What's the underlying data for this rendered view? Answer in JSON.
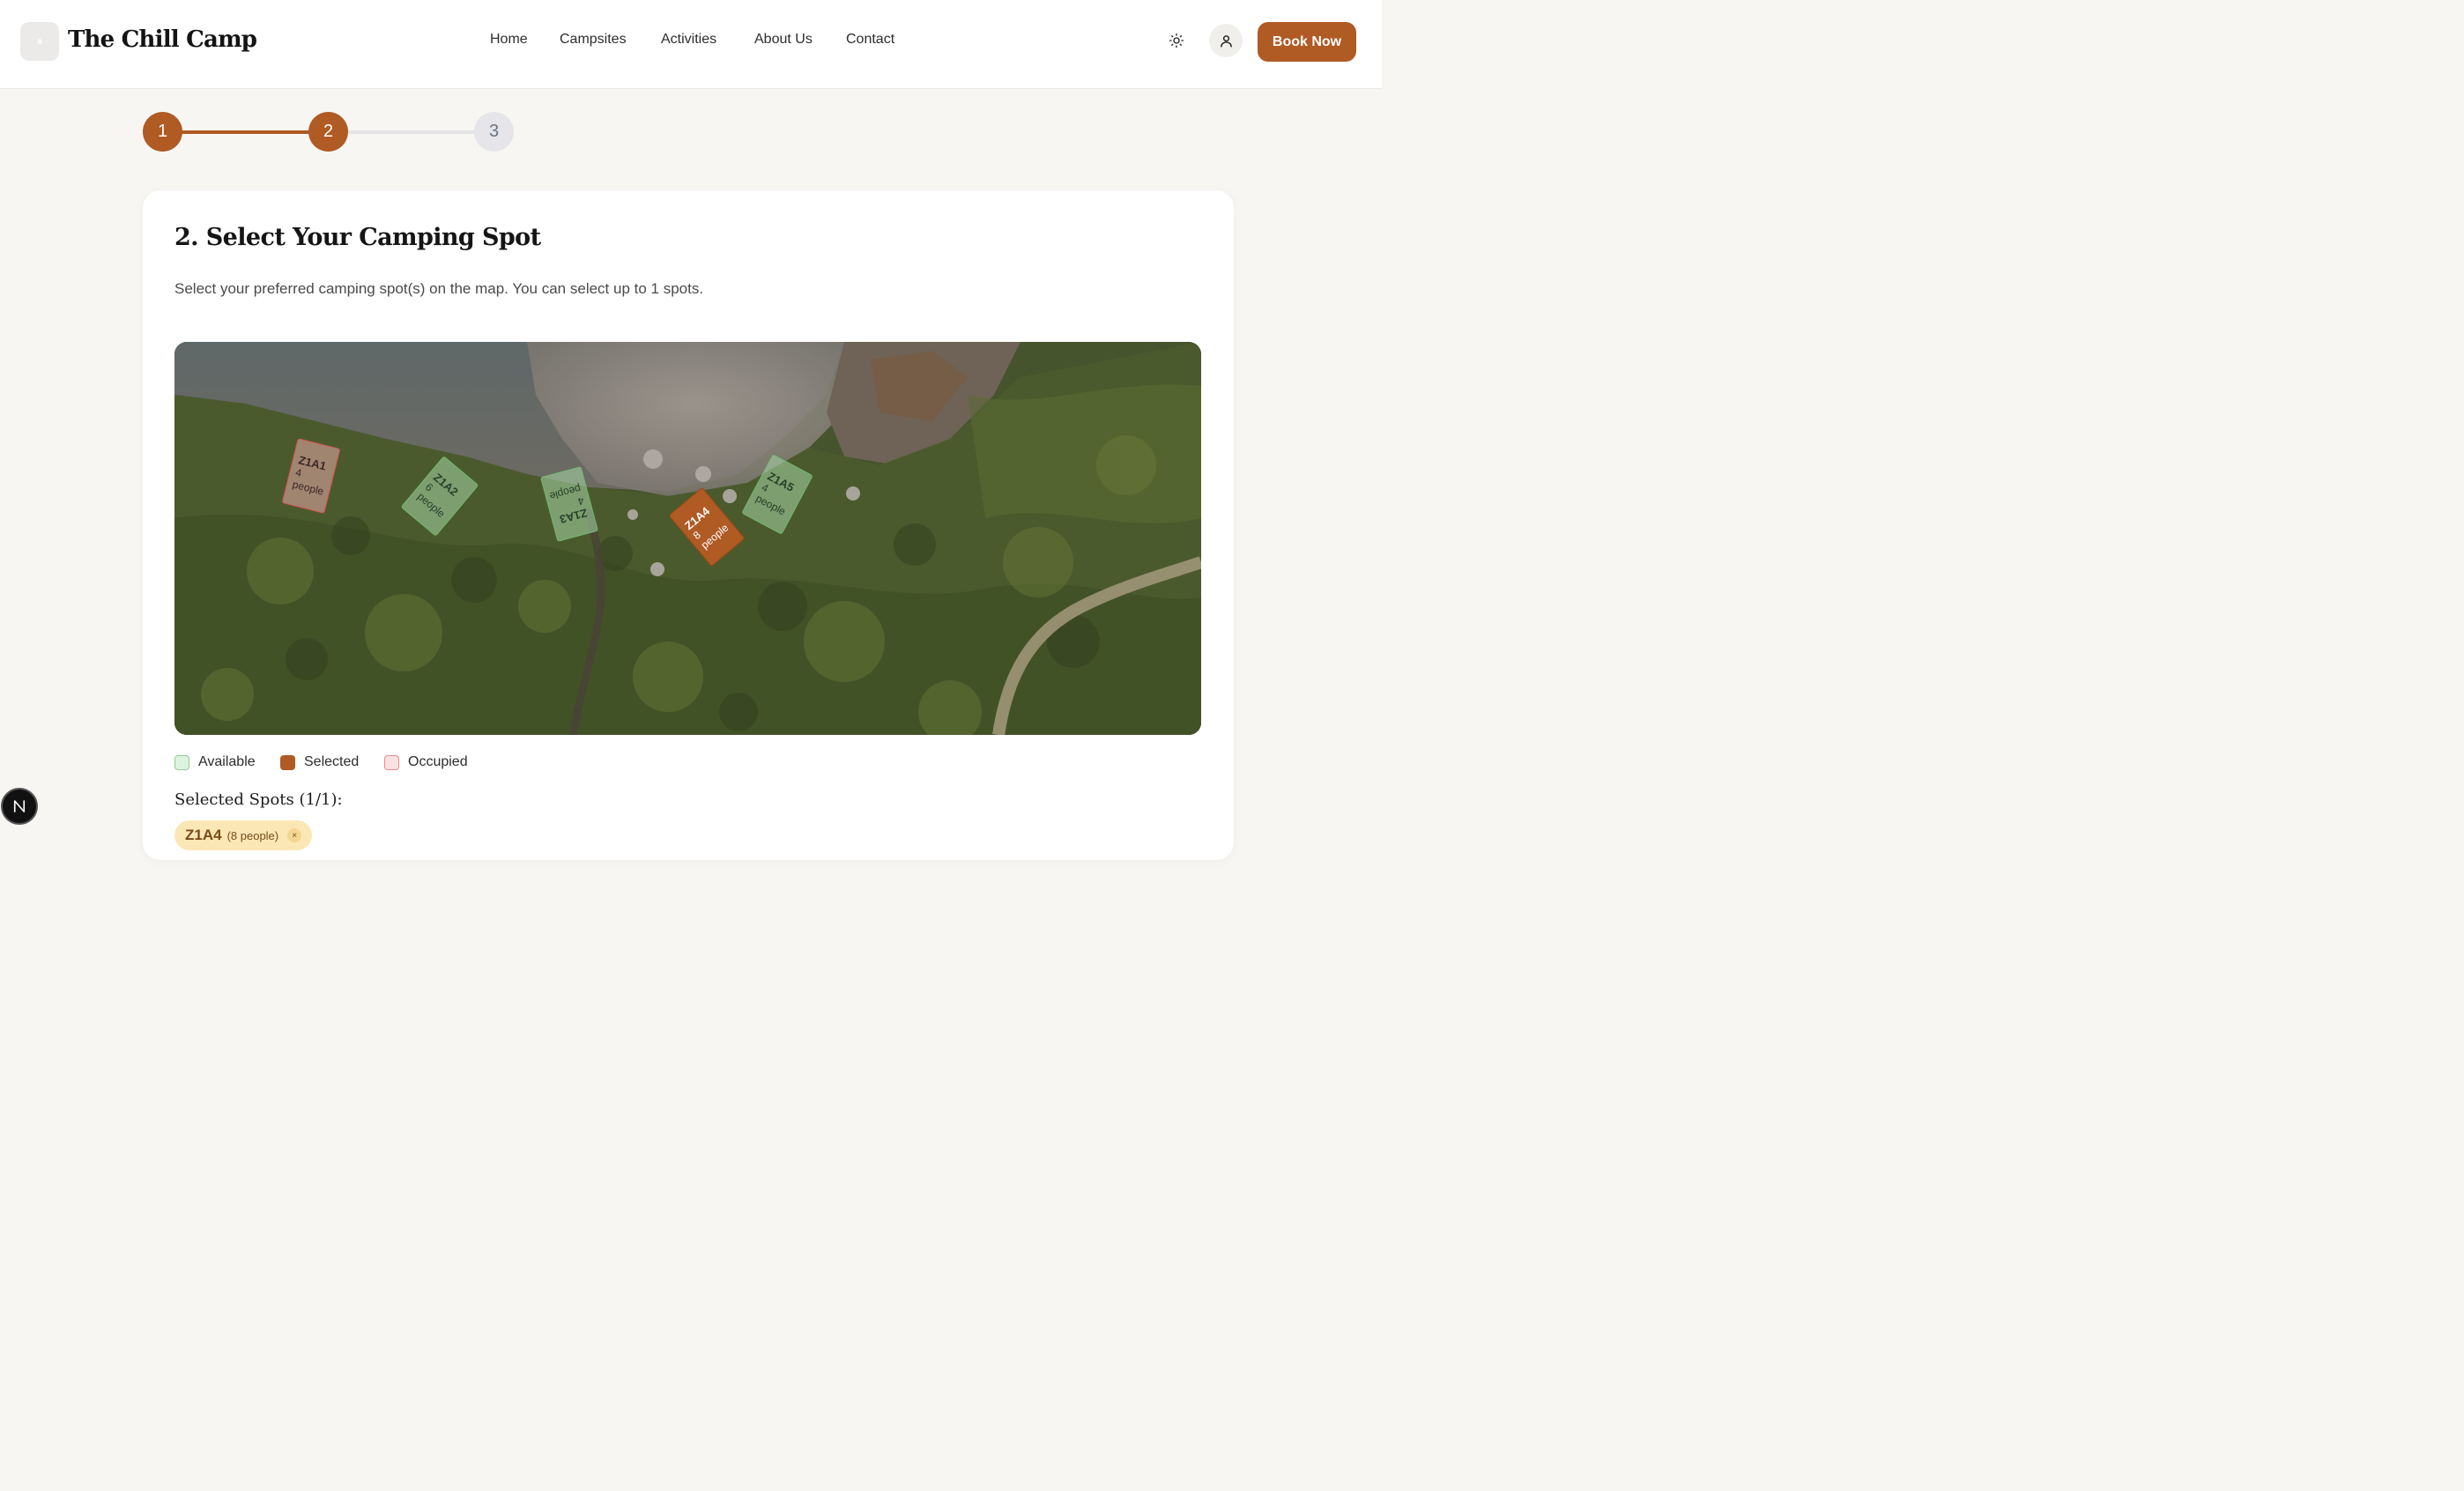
{
  "header": {
    "brand": "The Chill Camp",
    "nav": [
      "Home",
      "Campsites",
      "Activities",
      "About Us",
      "Contact"
    ],
    "icons": [
      "sun-icon",
      "user-icon"
    ],
    "book_label": "Book Now"
  },
  "stepper": {
    "steps": [
      "1",
      "2",
      "3"
    ],
    "current": 2
  },
  "section": {
    "title": "2. Select Your Camping Spot",
    "description": "Select your preferred camping spot(s) on the map. You can select up to 1 spots."
  },
  "map": {
    "spots": [
      {
        "id": "Z1A1",
        "capacity": "4",
        "unit": "people",
        "status": "occupied"
      },
      {
        "id": "Z1A2",
        "capacity": "6",
        "unit": "people",
        "status": "available"
      },
      {
        "id": "Z1A3",
        "capacity": "4",
        "unit": "people",
        "status": "available"
      },
      {
        "id": "Z1A4",
        "capacity": "8",
        "unit": "people",
        "status": "selected"
      },
      {
        "id": "Z1A5",
        "capacity": "4",
        "unit": "people",
        "status": "available"
      }
    ]
  },
  "legend": {
    "available": "Available",
    "selected": "Selected",
    "occupied": "Occupied"
  },
  "selection": {
    "title": "Selected Spots (1/1):",
    "chip_id": "Z1A4",
    "chip_capacity": "(8 people)",
    "remove_symbol": "×"
  },
  "floating": {
    "label": "N"
  },
  "colors": {
    "accent": "#b05a24",
    "available": "#8fce93",
    "occupied": "#e28c8c"
  }
}
